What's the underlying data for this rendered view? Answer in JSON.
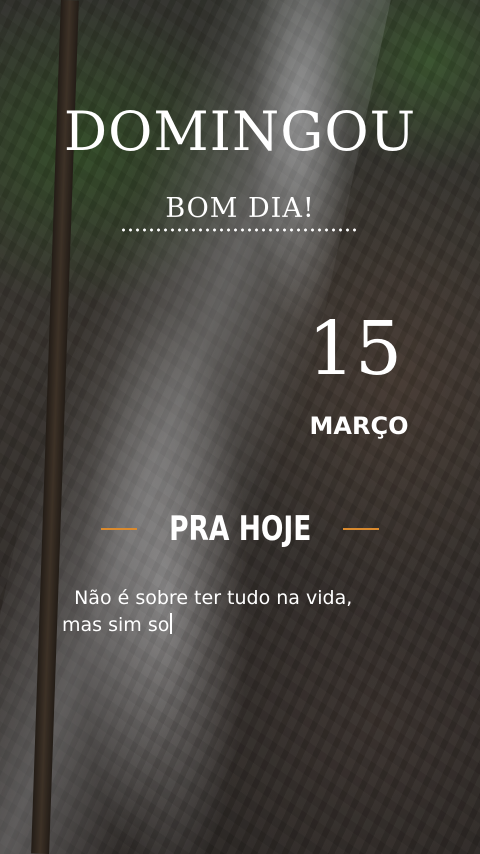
{
  "title": "DOMINGOU",
  "subtitle": "BOM DIA!",
  "date": {
    "day": "15",
    "month": "MARÇO"
  },
  "section": {
    "heading": "PRA HOJE"
  },
  "message": {
    "line1": "Não é sobre ter tudo na vida,",
    "line2": "mas sim so"
  },
  "colors": {
    "accent": "#d98a2e",
    "text": "#ffffff"
  },
  "background": "waterfall-photo"
}
